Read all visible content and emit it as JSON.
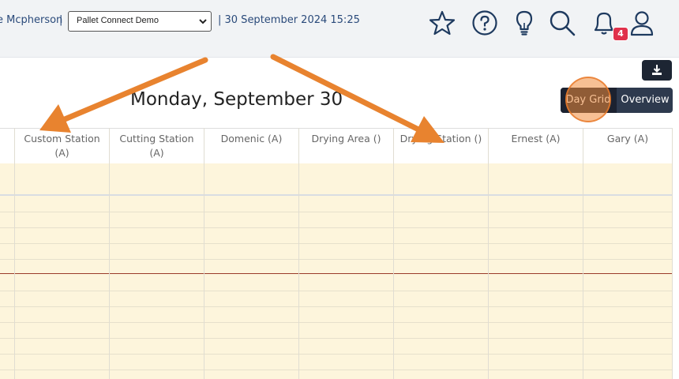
{
  "topbar": {
    "user_name": "e Mcpherson",
    "separator": "|",
    "site_select": {
      "selected": "Pallet Connect Demo"
    },
    "datetime": "| 30 September 2024 15:25",
    "notifications_count": "4",
    "icons": [
      "star-icon",
      "help-icon",
      "lightbulb-icon",
      "search-icon",
      "bell-icon",
      "user-icon"
    ]
  },
  "toolbar": {
    "download_icon": "download-icon",
    "views": {
      "day_grid": "Day Grid",
      "overview": "Overview"
    },
    "active_view": "Day Grid"
  },
  "calendar": {
    "title": "Monday, September 30",
    "columns": [
      {
        "line1": "Custom Station",
        "line2": "(A)"
      },
      {
        "line1": "Cutting Station",
        "line2": "(A)"
      },
      {
        "line1": "Domenic (A)",
        "line2": ""
      },
      {
        "line1": "Drying Area ()",
        "line2": ""
      },
      {
        "line1": "Drying Station ()",
        "line2": ""
      },
      {
        "line1": "Ernest (A)",
        "line2": ""
      },
      {
        "line1": "Gary (A)",
        "line2": ""
      }
    ]
  },
  "colors": {
    "accent": "#1c2230",
    "slot_background": "#fdf5dc",
    "badge": "#e0314b",
    "annotation_arrow": "#e8832f",
    "now_line": "#9a3b2a"
  }
}
